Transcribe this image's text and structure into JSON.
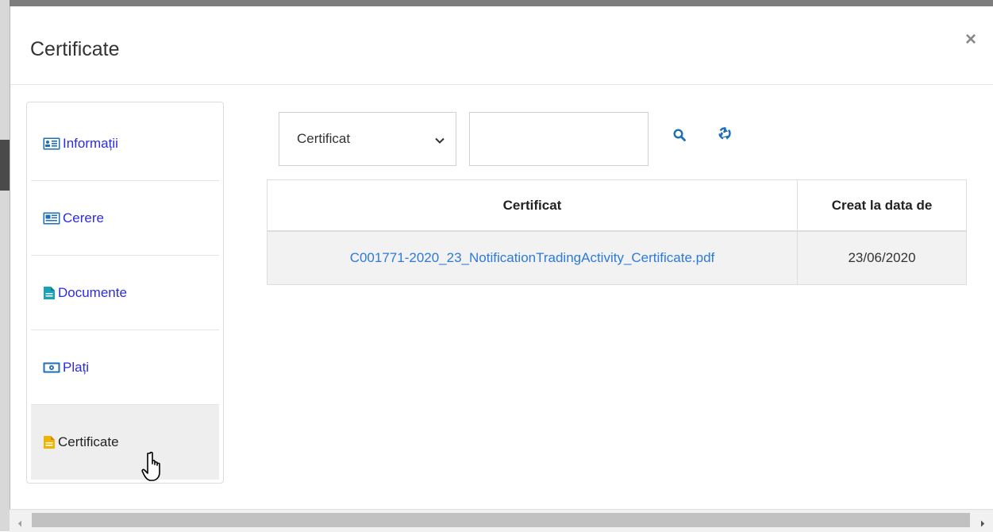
{
  "modal": {
    "title": "Certificate",
    "close_label": "×"
  },
  "sidebar": {
    "items": [
      {
        "label": "Informații",
        "icon": "id-card-icon",
        "color": "#2c2ce0"
      },
      {
        "label": "Cerere",
        "icon": "newspaper-icon",
        "color": "#2c2ce0"
      },
      {
        "label": "Documente",
        "icon": "file-text-icon",
        "color": "#2c2ce0"
      },
      {
        "label": "Plați",
        "icon": "money-bill-icon",
        "color": "#2c2ce0"
      },
      {
        "label": "Certificate",
        "icon": "file-icon",
        "color": "#f0b400",
        "active": true
      }
    ]
  },
  "filter": {
    "select_value": "Certificat",
    "input_value": ""
  },
  "table": {
    "headers": [
      "Certificat",
      "Creat la data de"
    ],
    "rows": [
      {
        "certificat": "C001771-2020_23_NotificationTradingActivity_Certificate.pdf",
        "creat": "23/06/2020"
      }
    ]
  },
  "colors": {
    "link": "#2d7ad8",
    "nav_link": "#2c2ce0",
    "icon_blue": "#1d6fb8",
    "icon_teal": "#17a2b8",
    "icon_yellow": "#f0b400"
  }
}
